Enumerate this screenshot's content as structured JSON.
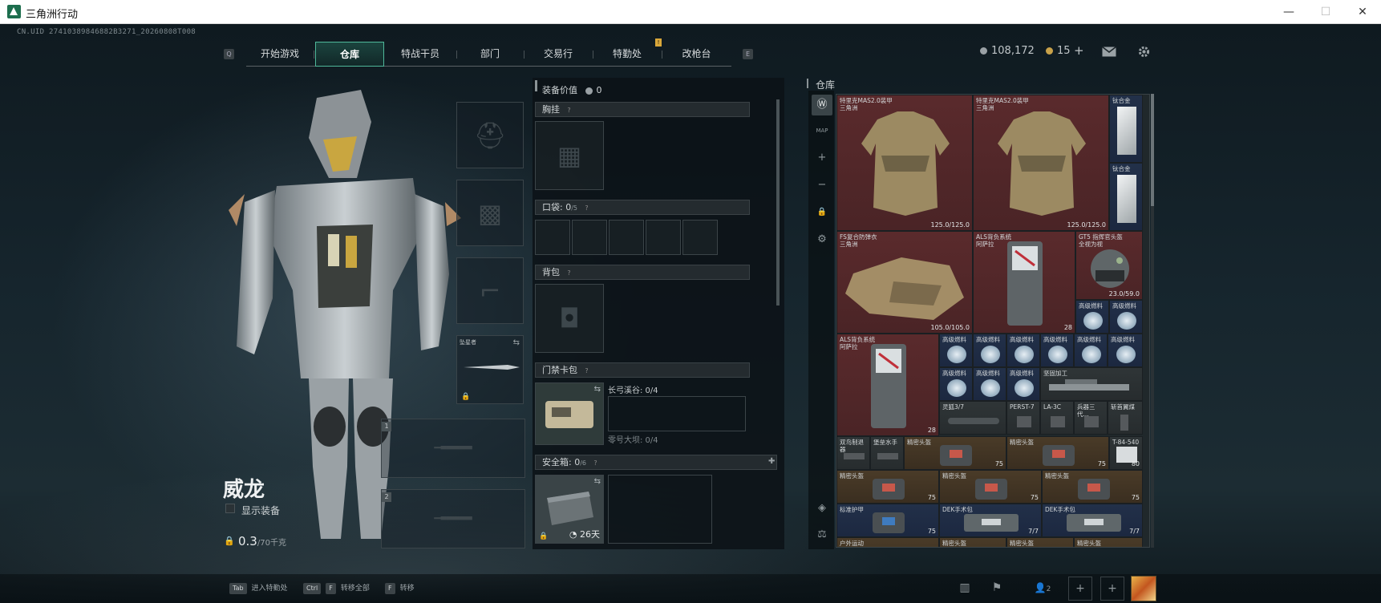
{
  "window": {
    "title": "三角洲行动",
    "minimize": "—",
    "maximize": "☐",
    "close": "✕"
  },
  "uid": "CN.UID 27410389846882B3271_20260808T008",
  "nav": {
    "left_key": "Q",
    "right_key": "E",
    "badge": "!",
    "tabs": [
      "开始游戏",
      "仓库",
      "特战干员",
      "部门",
      "交易行",
      "特勤处",
      "改枪台"
    ],
    "active": "仓库"
  },
  "currency": {
    "silver": "108,172",
    "gold": "15",
    "plus": "+"
  },
  "operator": {
    "name": "威龙",
    "show_equipment_label": "显示装备",
    "weight": "0.3",
    "weight_max": "/70千克"
  },
  "loadout": {
    "equip_value_label": "装备价值",
    "equip_value": "0",
    "chest_rig_label": "胸挂",
    "pocket_label": "口袋: ",
    "pocket_count": "0",
    "pocket_max": "/5",
    "backpack_label": "背包",
    "keycard_label": "门禁卡包",
    "keycard_rows": [
      "长弓溪谷: 0/4",
      "零号大坝: 0/4"
    ],
    "safebox_label": "安全箱: ",
    "safebox_count": "0",
    "safebox_max": "/6",
    "safebox_time": "26天",
    "melee_label": "坠星者",
    "slot1": "1",
    "slot2": "2"
  },
  "stash": {
    "title": "仓库",
    "sidebar": [
      "Ⓦ",
      "MAP",
      "+",
      "−",
      "🔒",
      "⚙",
      "◈",
      "⚖"
    ],
    "items": [
      {
        "name": "特里克MAS2.0装甲\n三角洲",
        "dur": "125.0/125.0"
      },
      {
        "name": "特里克MAS2.0装甲\n三角洲",
        "dur": "125.0/125.0"
      },
      {
        "name": "钛合金",
        "dur": ""
      },
      {
        "name": "钛合金",
        "dur": ""
      },
      {
        "name": "FS复合防弹衣\n三角洲",
        "dur": "105.0/105.0"
      },
      {
        "name": "ALS背负系统\n阿萨拉",
        "dur": "28"
      },
      {
        "name": "GT5 指挥官头盔\n全视为视",
        "dur": "23.0/59.0"
      },
      {
        "name": "高级燃料",
        "dur": ""
      },
      {
        "name": "ALS背负系统\n阿萨拉",
        "dur": "28"
      },
      {
        "name": "高级燃料",
        "dur": ""
      },
      {
        "name": "坚固加工",
        "dur": ""
      },
      {
        "name": "灵狐3/7",
        "dur": ""
      },
      {
        "name": "PERST-7",
        "dur": ""
      },
      {
        "name": "LA-3C",
        "dur": ""
      },
      {
        "name": "兵器三代...",
        "dur": ""
      },
      {
        "name": "斩首翼煤",
        "dur": ""
      },
      {
        "name": "双鸟制退器",
        "dur": ""
      },
      {
        "name": "堡垒水手",
        "dur": ""
      },
      {
        "name": "精密头盔",
        "dur": "75"
      },
      {
        "name": "精密头盔",
        "dur": "75"
      },
      {
        "name": "T-84-540",
        "dur": "80"
      },
      {
        "name": "精密头盔",
        "dur": "75"
      },
      {
        "name": "精密头盔",
        "dur": "75"
      },
      {
        "name": "精密头盔",
        "dur": "75"
      },
      {
        "name": "标准护甲",
        "dur": "75"
      },
      {
        "name": "DEK手术包",
        "dur": "7/7"
      },
      {
        "name": "DEK手术包",
        "dur": "7/7"
      },
      {
        "name": "户外运动",
        "dur": ""
      },
      {
        "name": "精密头盔",
        "dur": ""
      },
      {
        "name": "精密头盔",
        "dur": ""
      },
      {
        "name": "精密头盔",
        "dur": ""
      }
    ]
  },
  "hints": {
    "tab_key": "Tab",
    "tab_text": "进入特勤处",
    "ctrl_key": "Ctrl",
    "f_key": "F",
    "ctrl_text": "转移全部",
    "f2_key": "F",
    "f_text": "转移"
  },
  "bottom": {
    "stats_icon": "▮▯",
    "flag_icon": "⚑",
    "squad": "2",
    "add": "+"
  }
}
